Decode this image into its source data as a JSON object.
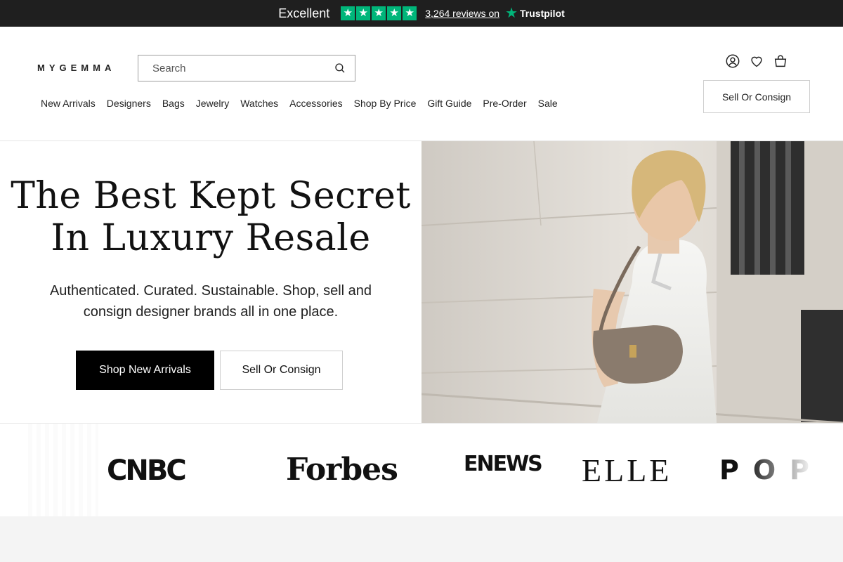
{
  "trustpilot": {
    "rating_label": "Excellent",
    "stars": [
      "star-icon",
      "star-icon",
      "star-icon",
      "star-icon",
      "star-icon"
    ],
    "reviews_text": "3,264 reviews on",
    "brand": "Trustpilot",
    "star_color": "#00b67a"
  },
  "header": {
    "logo_text": "MYGEMMA",
    "search_placeholder": "Search",
    "nav": [
      "New Arrivals",
      "Designers",
      "Bags",
      "Jewelry",
      "Watches",
      "Accessories",
      "Shop By Price",
      "Gift Guide",
      "Pre-Order",
      "Sale"
    ],
    "icons": [
      "account-icon",
      "wishlist-heart-icon",
      "shopping-bag-icon"
    ],
    "sell_button": "Sell Or Consign"
  },
  "hero": {
    "title_line1": "The Best Kept Secret",
    "title_line2": "In Luxury Resale",
    "subtitle": "Authenticated. Curated. Sustainable. Shop, sell and consign designer brands all in one place.",
    "primary_cta": "Shop New Arrivals",
    "secondary_cta": "Sell Or Consign"
  },
  "press": {
    "logos": [
      "CNBC",
      "Forbes",
      "ENEWS",
      "ELLE",
      "POP"
    ]
  },
  "colors": {
    "topbar": "#1f1f1f",
    "accent": "#000000"
  }
}
